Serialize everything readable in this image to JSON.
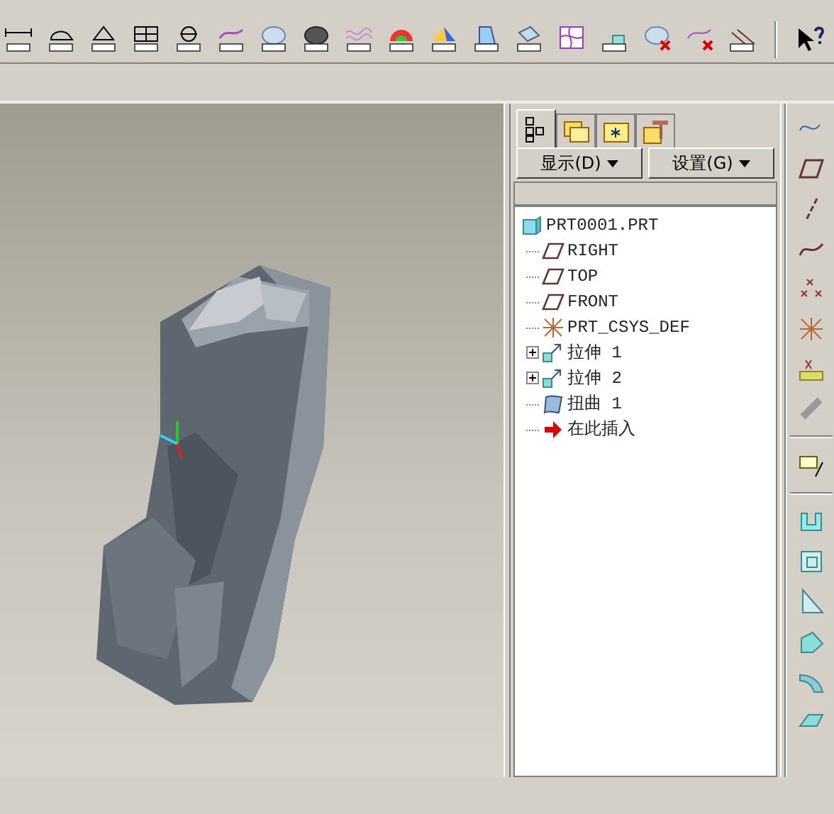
{
  "panel_tabs": [
    {
      "kind": "model-tree",
      "selected": true
    },
    {
      "kind": "folders",
      "selected": false
    },
    {
      "kind": "layers",
      "selected": false
    },
    {
      "kind": "tools",
      "selected": false
    }
  ],
  "panel_buttons": [
    "显示(D)",
    "设置(G)"
  ],
  "model_tree": {
    "label": "PRT0001.PRT",
    "kind": "part",
    "children": [
      {
        "label": "RIGHT",
        "kind": "plane"
      },
      {
        "label": "TOP",
        "kind": "plane"
      },
      {
        "label": "FRONT",
        "kind": "plane"
      },
      {
        "label": "PRT_CSYS_DEF",
        "kind": "csys"
      },
      {
        "label": "拉伸 1",
        "kind": "extrude",
        "expanded": false
      },
      {
        "label": "拉伸 2",
        "kind": "extrude",
        "expanded": false
      },
      {
        "label": "扭曲 1",
        "kind": "warp"
      },
      {
        "label": "在此插入",
        "kind": "insert"
      }
    ]
  }
}
